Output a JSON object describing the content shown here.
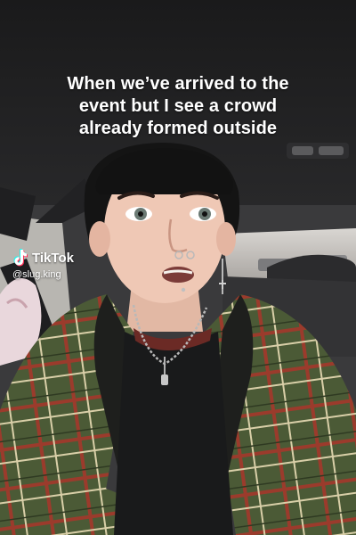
{
  "caption": {
    "lines": [
      "When we’ve arrived to the",
      "event but I see a crowd",
      "already formed outside"
    ]
  },
  "watermark": {
    "brand": "TikTok",
    "handle": "@slug.king",
    "logo_icon": "tiktok-logo-icon"
  },
  "colors": {
    "caption_text": "#ffffff",
    "jacket_green": "#4b5a36",
    "plaid_red": "#9b3b2c",
    "plaid_cream": "#d9cfa8"
  }
}
